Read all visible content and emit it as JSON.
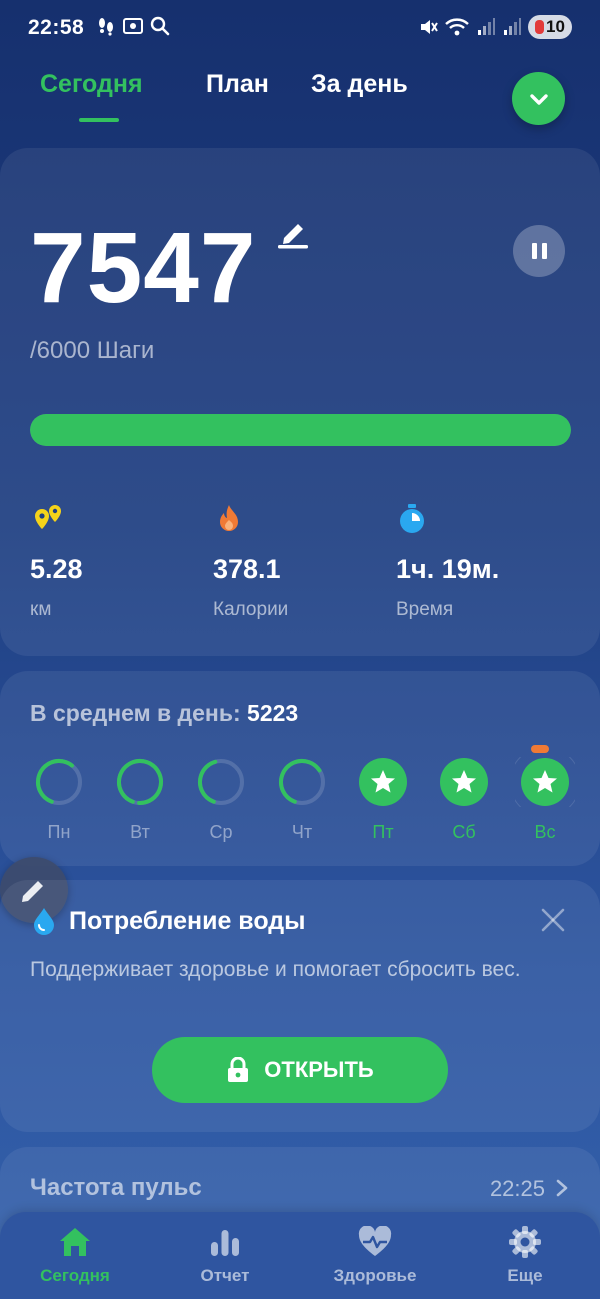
{
  "status_bar": {
    "time": "22:58",
    "battery": "10"
  },
  "tabs": [
    {
      "label": "Сегодня",
      "active": true
    },
    {
      "label": "План",
      "active": false
    },
    {
      "label": "За день",
      "active": false
    }
  ],
  "steps": {
    "count": "7547",
    "goal_text": "/6000 Шаги",
    "progress_percent": 100
  },
  "stats": [
    {
      "icon": "location-pins-icon",
      "value": "5.28",
      "label": "км"
    },
    {
      "icon": "flame-icon",
      "value": "378.1",
      "label": "Калории"
    },
    {
      "icon": "timer-icon",
      "value": "1ч. 19м.",
      "label": "Время"
    }
  ],
  "weekly": {
    "title_prefix": "В среднем в день: ",
    "average": "5223",
    "days": [
      {
        "label": "Пн",
        "progress": 0.55,
        "done": false
      },
      {
        "label": "Вт",
        "progress": 0.95,
        "done": false
      },
      {
        "label": "Ср",
        "progress": 0.4,
        "done": false
      },
      {
        "label": "Чт",
        "progress": 0.6,
        "done": false
      },
      {
        "label": "Пт",
        "progress": 1,
        "done": true
      },
      {
        "label": "Сб",
        "progress": 1,
        "done": true
      },
      {
        "label": "Вс",
        "progress": 1,
        "done": true,
        "today": true
      }
    ]
  },
  "water": {
    "title": "Потребление воды",
    "description": "Поддерживает здоровье и помогает сбросить вес.",
    "button_label": "ОТКРЫТЬ"
  },
  "pulse": {
    "title": "Частота пульс",
    "time": "22:25"
  },
  "bottom_nav": [
    {
      "label": "Сегодня",
      "icon": "home-icon",
      "active": true
    },
    {
      "label": "Отчет",
      "icon": "bar-chart-icon",
      "active": false
    },
    {
      "label": "Здоровье",
      "icon": "heart-pulse-icon",
      "active": false
    },
    {
      "label": "Еще",
      "icon": "gear-icon",
      "active": false
    }
  ],
  "colors": {
    "accent": "#33c15f",
    "background": "#1f3f82",
    "water_drop": "#2aa8f0",
    "flame": "#f07a35",
    "pins": "#f5d31a"
  }
}
